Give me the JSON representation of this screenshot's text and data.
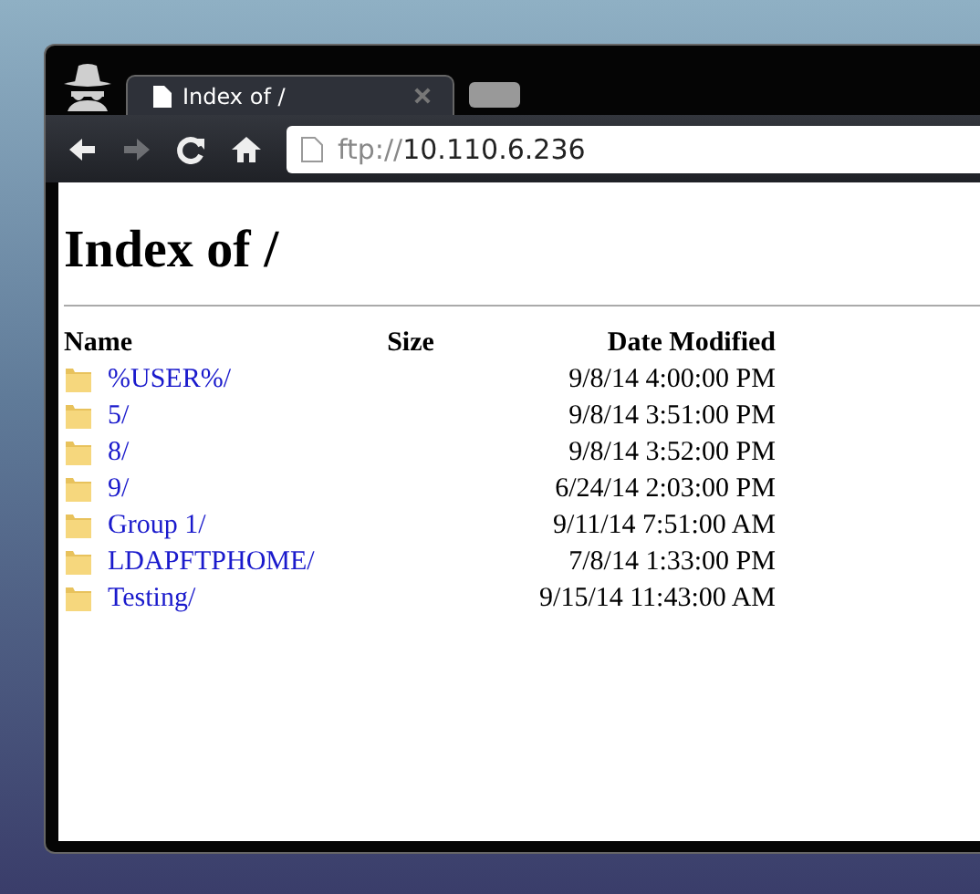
{
  "browser": {
    "tabs": [
      {
        "title": "Index of /",
        "selected": true
      }
    ],
    "toolbar": [
      {
        "kind": "back",
        "disabled": false
      },
      {
        "kind": "forward",
        "disabled": true
      },
      {
        "kind": "reload",
        "disabled": false
      },
      {
        "kind": "home",
        "disabled": false
      }
    ],
    "address": {
      "scheme": "ftp://",
      "host": "10.110.6.236"
    }
  },
  "page": {
    "heading": "Index of /",
    "columns": [
      "Name",
      "Size",
      "Date Modified"
    ],
    "rows": [
      {
        "name": "%USER%/",
        "date": "9/8/14 4:00:00 PM"
      },
      {
        "name": "5/",
        "date": "9/8/14 3:51:00 PM"
      },
      {
        "name": "8/",
        "date": "9/8/14 3:52:00 PM"
      },
      {
        "name": "9/",
        "date": "6/24/14 2:03:00 PM"
      },
      {
        "name": "Group 1/",
        "date": "9/11/14 7:51:00 AM"
      },
      {
        "name": "LDAPFTPHOME/",
        "date": "7/8/14 1:33:00 PM"
      },
      {
        "name": "Testing/",
        "date": "9/15/14 11:43:00 AM"
      }
    ]
  }
}
